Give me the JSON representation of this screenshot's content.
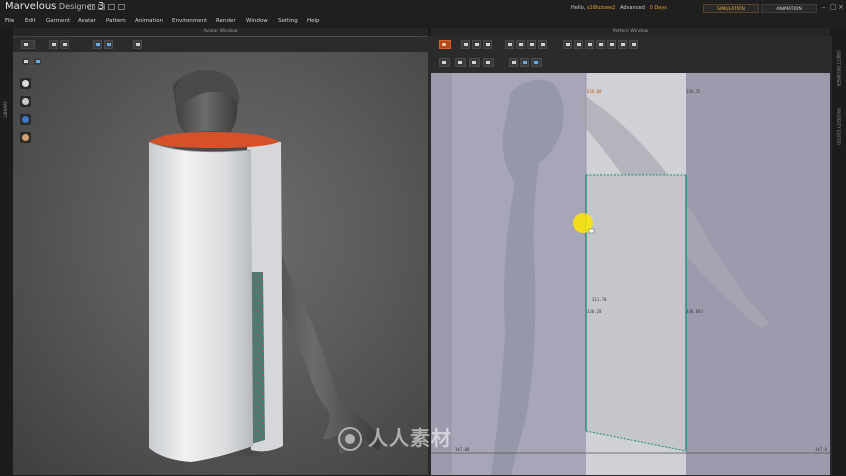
{
  "app": {
    "name": "Marvelous",
    "sub": " Designer",
    "version": " 3"
  },
  "account": {
    "hello": "Hello,",
    "username": "s2l8ozoee2",
    "edition": "Advanced",
    "days": "0 Days"
  },
  "modes": {
    "simulation": "SIMULATION",
    "animation": "ANIMATION"
  },
  "window_controls": [
    "–",
    "□",
    "×"
  ],
  "menu": [
    "File",
    "Edit",
    "Garment",
    "Avatar",
    "Pattern",
    "Animation",
    "Environment",
    "Render",
    "Window",
    "Setting",
    "Help"
  ],
  "windows": {
    "avatar": {
      "title": "Avatar Window"
    },
    "pattern": {
      "title": "Pattern Window"
    }
  },
  "side_panels": {
    "left": "LIBRARY",
    "right_1": "OBJECT BROWSER",
    "right_2": "PROPERTY EDITOR"
  },
  "avatar_tools": [
    "shirt-icon",
    "avatar-icon",
    "magnet-icon",
    "head-icon"
  ],
  "pattern_measurements": {
    "top_left": "638.00",
    "top_right": "339.35",
    "mid_1": "311.70",
    "mid_2": "330.28",
    "right_edge": "330.893",
    "bottom_left": "347.00",
    "bottom_right": "347.0"
  },
  "watermark": "人人素材",
  "colors": {
    "accent": "#e59d2a",
    "panel": "#2b2b2b",
    "pattern_bg": "#9a9aaa",
    "fabric": "#cfd2d6",
    "seam": "#1e8f73",
    "cursor": "#ffe600"
  }
}
